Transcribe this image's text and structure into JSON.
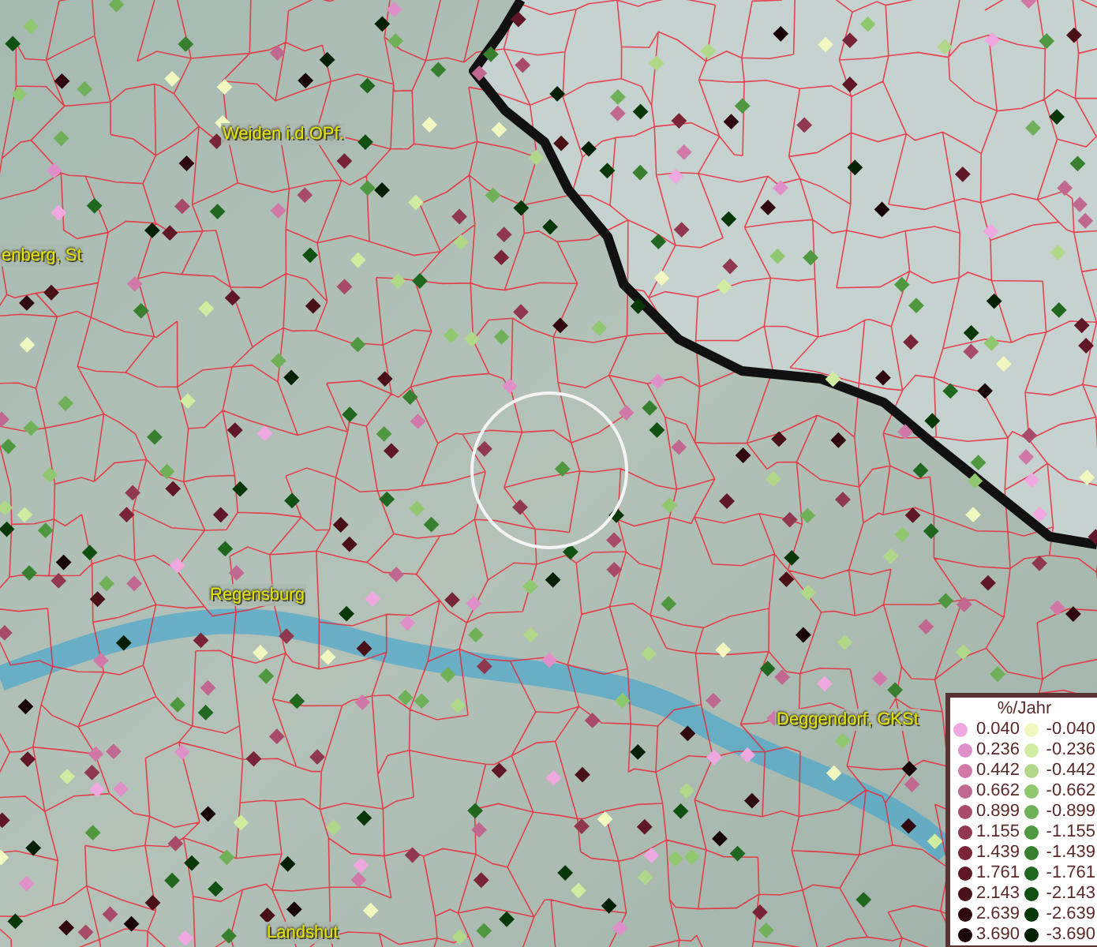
{
  "map": {
    "places": [
      {
        "name": "Weiden i.d.OPf."
      },
      {
        "name": "enberg, St"
      },
      {
        "name": "Regensburg"
      },
      {
        "name": "Deggendorf, GKSt"
      },
      {
        "name": "Landshut"
      }
    ]
  },
  "legend": {
    "title": "%/Jahr",
    "positive": [
      {
        "value": "0.040",
        "color": "#f0a8e0"
      },
      {
        "value": "0.236",
        "color": "#e090c8"
      },
      {
        "value": "0.442",
        "color": "#d078a8"
      },
      {
        "value": "0.662",
        "color": "#c06890"
      },
      {
        "value": "0.899",
        "color": "#a84a6a"
      },
      {
        "value": "1.155",
        "color": "#903850"
      },
      {
        "value": "1.439",
        "color": "#7a2438"
      },
      {
        "value": "1.761",
        "color": "#601828"
      },
      {
        "value": "2.143",
        "color": "#4a1018"
      },
      {
        "value": "2.639",
        "color": "#300810"
      },
      {
        "value": "3.690",
        "color": "#180408"
      }
    ],
    "negative": [
      {
        "value": "-0.040",
        "color": "#f0f8c0"
      },
      {
        "value": "-0.236",
        "color": "#d0eca0"
      },
      {
        "value": "-0.442",
        "color": "#b0d888"
      },
      {
        "value": "-0.662",
        "color": "#90c870"
      },
      {
        "value": "-0.899",
        "color": "#70b058"
      },
      {
        "value": "-1.155",
        "color": "#509840"
      },
      {
        "value": "-1.439",
        "color": "#388030"
      },
      {
        "value": "-1.761",
        "color": "#206820"
      },
      {
        "value": "-2.143",
        "color": "#105010"
      },
      {
        "value": "-2.639",
        "color": "#083808"
      },
      {
        "value": "-3.690",
        "color": "#042004"
      }
    ]
  }
}
